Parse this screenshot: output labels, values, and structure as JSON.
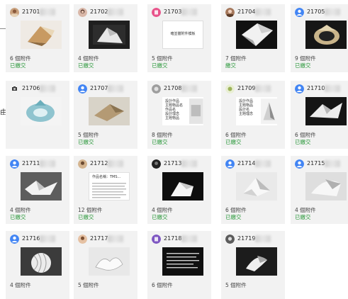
{
  "page": {
    "edge_char": "由"
  },
  "cards": [
    {
      "id": "21701",
      "count": "6 個附件",
      "status": "已繳交",
      "avatar": "photo-warm"
    },
    {
      "id": "21702",
      "count": "4 個附件",
      "status": "已繳交",
      "avatar": "photo-girl"
    },
    {
      "id": "21703",
      "count": "5 個附件",
      "status": "已繳交",
      "avatar": "pink-letter",
      "thumb_text": "確並體附件模板"
    },
    {
      "id": "21704",
      "count": "7 個附件",
      "status": "繳交",
      "avatar": "photo-brown"
    },
    {
      "id": "21705",
      "count": "9 個附件",
      "status": "已繳交",
      "avatar": "default-user"
    },
    {
      "id": "21706",
      "count": "",
      "status": "",
      "avatar": "photo-dark"
    },
    {
      "id": "21707",
      "count": "5 個附件",
      "status": "已繳交",
      "avatar": "default-user"
    },
    {
      "id": "21708",
      "count": "8 個附件",
      "status": "已繳交",
      "avatar": "photo-gray",
      "thumb_text": "設計作品\n主題物品名\n作品名\n設計理念\n主題物品"
    },
    {
      "id": "21709",
      "count": "6 個附件",
      "status": "已繳交",
      "avatar": "photo-green",
      "thumb_text": "設計作品\n主題物品\n設計名\n主題理念"
    },
    {
      "id": "21710",
      "count": "6 個附件",
      "status": "已繳交",
      "avatar": "default-user"
    },
    {
      "id": "21711",
      "count": "4 個附件",
      "status": "已繳交",
      "avatar": "default-user"
    },
    {
      "id": "21712",
      "count": "12 個附件",
      "status": "已繳交",
      "avatar": "photo-tan",
      "thumb_text": "作品名稱：TMS..."
    },
    {
      "id": "21713",
      "count": "4 個附件",
      "status": "已繳交",
      "avatar": "photo-black"
    },
    {
      "id": "21714",
      "count": "6 個附件",
      "status": "已繳交",
      "avatar": "default-user"
    },
    {
      "id": "21715",
      "count": "4 個附件",
      "status": "已繳交",
      "avatar": "default-user"
    },
    {
      "id": "21716",
      "count": "4 個附件",
      "status": "",
      "avatar": "default-user"
    },
    {
      "id": "21717",
      "count": "5 個附件",
      "status": "",
      "avatar": "photo-peach"
    },
    {
      "id": "21718",
      "count": "6 個附件",
      "status": "",
      "avatar": "purple-letter"
    },
    {
      "id": "21719",
      "count": "5 個附件",
      "status": "",
      "avatar": "photo-mono"
    }
  ],
  "colors": {
    "card_bg": "#f2f2f2",
    "submitted": "#2e9a3e",
    "default_avatar": "#4285f4"
  }
}
